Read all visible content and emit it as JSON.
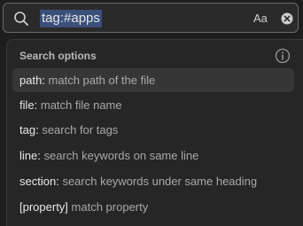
{
  "search": {
    "query": "tag:#apps",
    "match_case_label": "Aa"
  },
  "popup": {
    "title": "Search options",
    "options": [
      {
        "key": "path:",
        "desc": "match path of the file",
        "selected": true
      },
      {
        "key": "file:",
        "desc": "match file name",
        "selected": false
      },
      {
        "key": "tag:",
        "desc": "search for tags",
        "selected": false
      },
      {
        "key": "line:",
        "desc": "search keywords on same line",
        "selected": false
      },
      {
        "key": "section:",
        "desc": "search keywords under same heading",
        "selected": false
      },
      {
        "key": "[property]",
        "desc": "match property",
        "selected": false
      }
    ]
  },
  "colors": {
    "query_highlight": "#3a4f7a",
    "selected_row": "#363636"
  }
}
